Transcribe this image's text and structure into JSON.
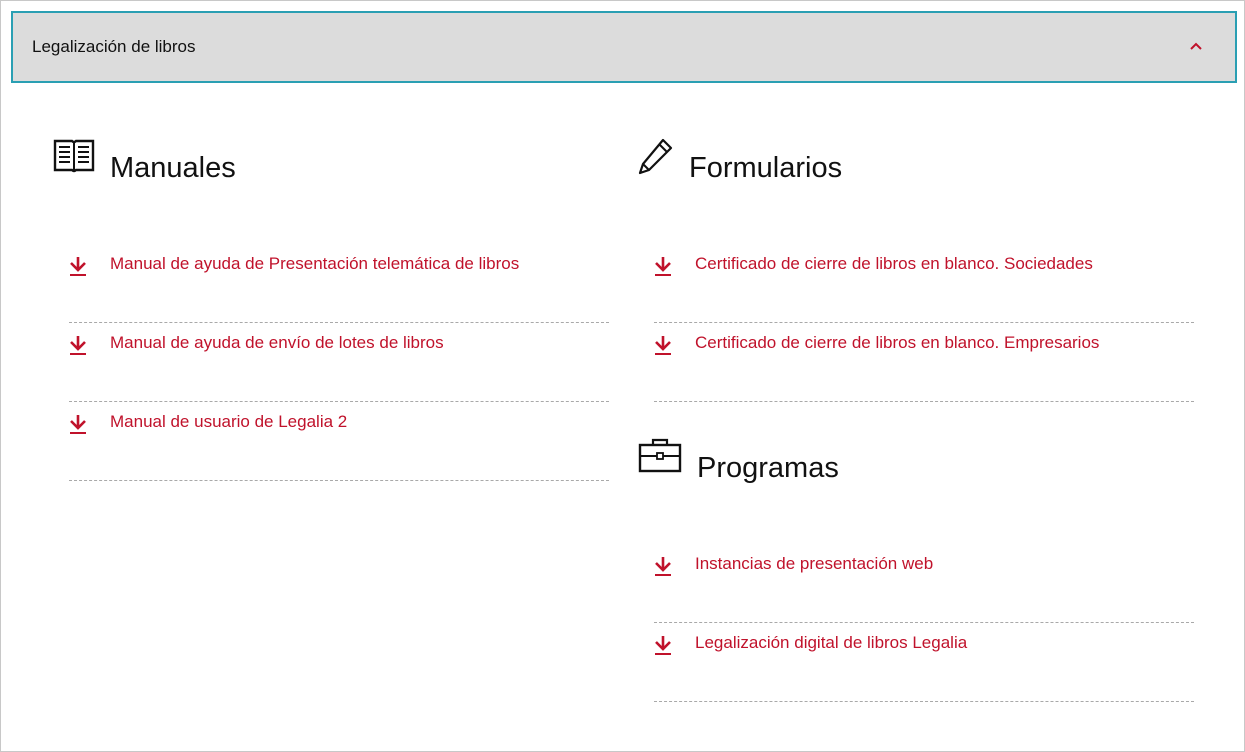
{
  "accordion": {
    "title": "Legalización de libros",
    "state_icon": "chevron-up-icon",
    "accent_color": "#2a9fb3"
  },
  "colors": {
    "link": "#c0122b",
    "header_bg": "#dcdcdc",
    "text": "#111111"
  },
  "sections": {
    "manuales": {
      "title": "Manuales",
      "icon": "open-book-icon",
      "items": [
        {
          "label": "Manual de ayuda de Presentación telemática de libros",
          "icon": "download-icon"
        },
        {
          "label": "Manual de ayuda de envío de lotes de libros",
          "icon": "download-icon"
        },
        {
          "label": "Manual de usuario de Legalia 2",
          "icon": "download-icon"
        }
      ]
    },
    "formularios": {
      "title": "Formularios",
      "icon": "pencil-icon",
      "items": [
        {
          "label": "Certificado de cierre de libros en blanco. Sociedades",
          "icon": "download-icon"
        },
        {
          "label": "Certificado de cierre de libros en blanco. Empresarios",
          "icon": "download-icon"
        }
      ]
    },
    "programas": {
      "title": "Programas",
      "icon": "briefcase-icon",
      "items": [
        {
          "label": "Instancias de presentación web",
          "icon": "download-icon"
        },
        {
          "label": "Legalización digital de libros Legalia",
          "icon": "download-icon"
        }
      ]
    }
  }
}
